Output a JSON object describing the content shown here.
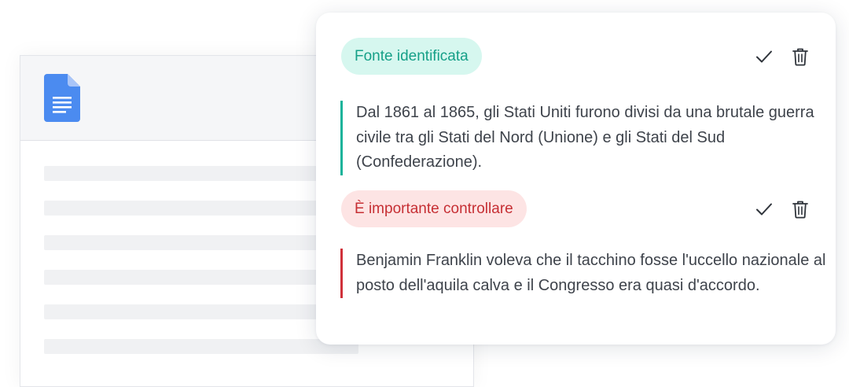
{
  "panel": {
    "items": [
      {
        "tag": "Fonte identificata",
        "text": "Dal 1861 al 1865, gli Stati Uniti furono divisi da una brutale guerra civile tra gli Stati del Nord (Unione) e gli Stati del Sud (Confederazione).",
        "status_color": "#16a088"
      },
      {
        "tag": "È importante controllare",
        "text": "Benjamin Franklin voleva che il tacchino fosse l'uccello nazionale al posto dell'aquila calva e il Congresso era quasi d'accordo.",
        "status_color": "#c62f34"
      }
    ],
    "icons": {
      "accept": "check-icon",
      "delete": "trash-icon"
    }
  },
  "document": {
    "icon": "google-docs-icon"
  }
}
